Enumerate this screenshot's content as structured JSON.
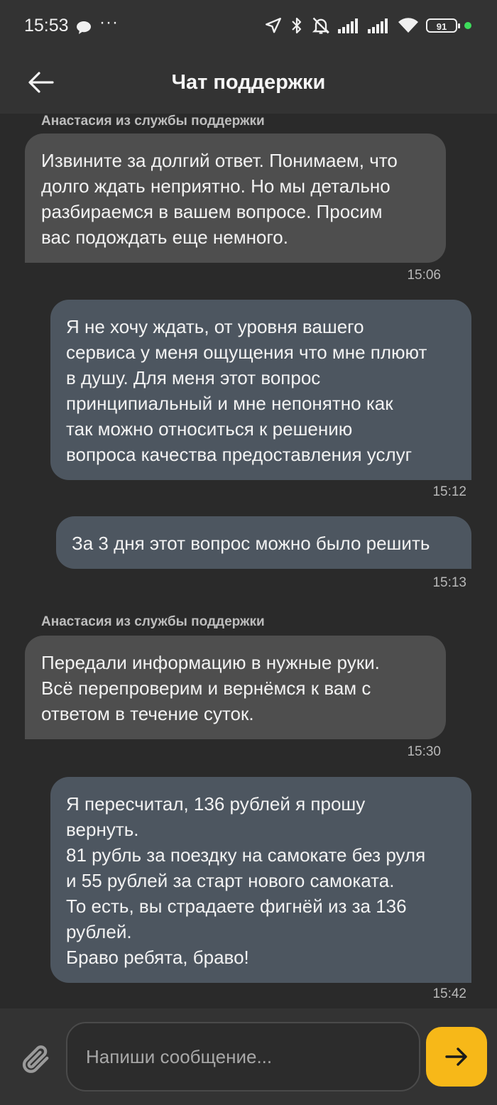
{
  "status_bar": {
    "time": "15:53",
    "battery": "91"
  },
  "header": {
    "title": "Чат поддержки"
  },
  "messages": [
    {
      "side": "in",
      "sender": "Анастасия из службы поддержки",
      "text": "Извините за долгий ответ. Понимаем, что\nдолго ждать неприятно. Но мы детально\nразбираемся в вашем вопросе. Просим\nвас подождать еще немного.",
      "time": "15:06"
    },
    {
      "side": "out",
      "text": "Я не хочу ждать, от уровня вашего\nсервиса у меня ощущения что мне плюют\nв душу. Для меня этот вопрос\nпринципиальный и мне непонятно как\nтак можно относиться к решению\nвопроса качества предоставления услуг",
      "time": "15:12"
    },
    {
      "side": "out",
      "text": "За 3 дня этот вопрос можно было решить",
      "time": "15:13"
    },
    {
      "side": "in",
      "sender": "Анастасия из службы поддержки",
      "text": "Передали информацию в нужные руки.\nВсё перепроверим и вернёмся к вам с\nответом в течение суток.",
      "time": "15:30"
    },
    {
      "side": "out",
      "text": "Я пересчитал, 136 рублей я прошу\nвернуть.\n81 рубль за поездку на самокате без руля\nи 55 рублей за старт нового самоката.\nТо есть, вы страдаете фигнёй из за 136\nрублей.\nБраво ребята, браво!",
      "time": "15:42"
    }
  ],
  "composer": {
    "placeholder": "Напиши сообщение..."
  },
  "icons": {
    "back": "arrow-left-icon",
    "attach": "paperclip-icon",
    "send": "arrow-right-icon",
    "accent": "#f7b818",
    "incoming_bubble": "#4e4e4e",
    "outgoing_bubble": "#4d5660"
  }
}
